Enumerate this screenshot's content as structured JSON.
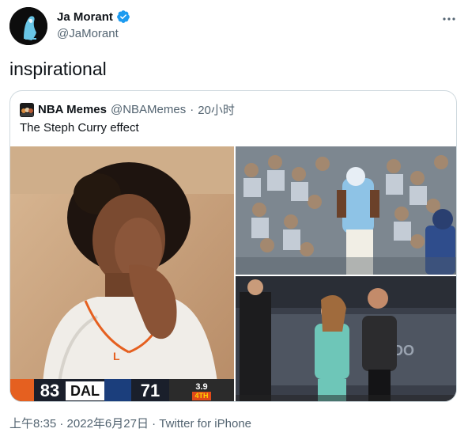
{
  "author": {
    "name": "Ja Morant",
    "handle": "@JaMorant",
    "verified": true
  },
  "menu_icon": "more-horizontal-icon",
  "tweet": {
    "text": "inspirational"
  },
  "quoted": {
    "name": "NBA Memes",
    "handle": "@NBAMemes",
    "separator": "·",
    "time": "20小时",
    "text": "The Steph Curry effect",
    "media": [
      {
        "scoreboard": {
          "home_score": "83",
          "away_team": "DAL",
          "away_score": "71",
          "clock": "3.9",
          "period": "4TH"
        }
      }
    ]
  },
  "meta": {
    "time": "上午8:35",
    "separator": "·",
    "date": "2022年6月27日",
    "separator2": "·",
    "source": "Twitter for iPhone"
  },
  "colors": {
    "text_primary": "#0f1419",
    "text_secondary": "#536471",
    "verified_blue": "#1d9bf0",
    "border": "#cfd9de"
  }
}
